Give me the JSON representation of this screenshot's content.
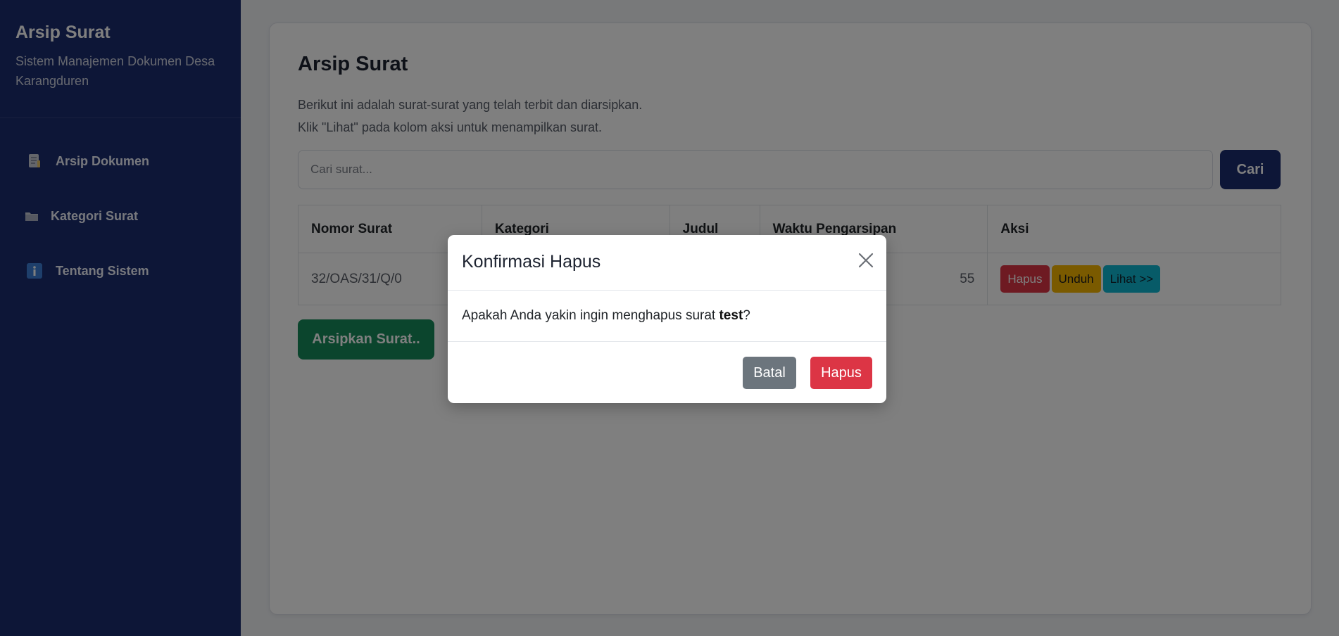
{
  "sidebar": {
    "brand_title": "Arsip Surat",
    "brand_subtitle": "Sistem Manajemen Dokumen Desa Karangduren",
    "items": [
      {
        "label": "Arsip Dokumen",
        "icon": "document-icon"
      },
      {
        "label": "Kategori Surat",
        "icon": "folder-icon"
      },
      {
        "label": "Tentang Sistem",
        "icon": "info-icon"
      }
    ]
  },
  "main": {
    "title": "Arsip Surat",
    "description_line1": "Berikut ini adalah surat-surat yang telah terbit dan diarsipkan.",
    "description_line2": "Klik \"Lihat\" pada kolom aksi untuk menampilkan surat.",
    "search": {
      "placeholder": "Cari surat...",
      "value": "",
      "button_label": "Cari"
    },
    "table": {
      "headers": [
        "Nomor Surat",
        "Kategori",
        "Judul",
        "Waktu Pengarsipan",
        "Aksi"
      ],
      "rows": [
        {
          "nomor": "32/OAS/31/Q/0",
          "kategori": "",
          "judul": "",
          "waktu": "55",
          "actions": {
            "delete": "Hapus",
            "download": "Unduh",
            "view": "Lihat >>"
          }
        }
      ]
    },
    "archive_button": "Arsipkan Surat.."
  },
  "modal": {
    "title": "Konfirmasi Hapus",
    "message_prefix": "Apakah Anda yakin ingin menghapus surat ",
    "message_target": "test",
    "message_suffix": "?",
    "cancel_label": "Batal",
    "confirm_label": "Hapus"
  },
  "colors": {
    "sidebar_bg": "#1a2c6e",
    "primary": "#1a2c6e",
    "success": "#178a5a",
    "danger": "#dc3545",
    "warning": "#f5b400",
    "info": "#0fb6d1",
    "secondary": "#6c757d"
  }
}
